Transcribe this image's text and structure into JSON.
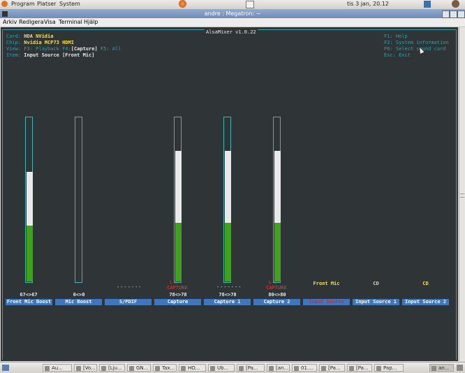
{
  "top_panel": {
    "menu_program": "Program",
    "menu_platser": "Platser",
    "menu_system": "System",
    "clock": "tis  3 jan, 20.12"
  },
  "window": {
    "title": "andre : Megatron: ~"
  },
  "menubar": {
    "arkiv": "Arkiv",
    "redigera": "Redigera",
    "visa": "Visa",
    "terminal": "Terminal",
    "hjalp": "Hjälp"
  },
  "alsamixer": {
    "title": "AlsaMixer v1.0.22",
    "card_label": "Card:",
    "card_value": "HDA NVidia",
    "chip_label": "Chip:",
    "chip_value": "Nvidia MCP73 HDMI",
    "view_label": "View:",
    "view_f3": "F3: Playback",
    "view_f4_key": "F4:",
    "view_f4_value": "[Capture]",
    "view_f5": "F5: All",
    "item_label": "Item:",
    "item_value": "Input Source [Front Mic]",
    "help": [
      "F1:  Help",
      "F2:  System information",
      "F6:  Select sound card",
      "Esc: Exit"
    ],
    "channels": [
      {
        "name": "Front Mic Boost",
        "level_text": "67<>67",
        "level": 0.67,
        "white_frac": 0.33
      },
      {
        "name": "Mic Boost",
        "level_text": "0<>0",
        "level": 0,
        "white_frac": 0
      },
      {
        "name": "S/PDIF",
        "dots": "-------"
      },
      {
        "name": "Capture",
        "level_text": "78<>78",
        "level": 0.8,
        "white_frac": 0.44,
        "capture": "CAPTURE",
        "lr": "L   R"
      },
      {
        "name": "Capture 1",
        "level_text": "78<>78",
        "level": 0.8,
        "white_frac": 0.44,
        "dots": "-------"
      },
      {
        "name": "Capture 2",
        "level_text": "80<>80",
        "level": 0.8,
        "white_frac": 0.44,
        "capture": "CAPTURE",
        "lr": "L   R"
      },
      {
        "name": "Input Source",
        "source": "Front Mic",
        "active": true
      },
      {
        "name": "Input Source 1",
        "source": "CD"
      },
      {
        "name": "Input Source 2",
        "source": "CD"
      }
    ]
  },
  "taskbar": [
    "Au...",
    "[Vo...",
    "[Lju...",
    "GN...",
    "Tax...",
    "HO...",
    "Ub...",
    "[Pa...",
    "[an...",
    "01....",
    "[Pa...",
    "[Pa...",
    "Pap...",
    "an..."
  ]
}
